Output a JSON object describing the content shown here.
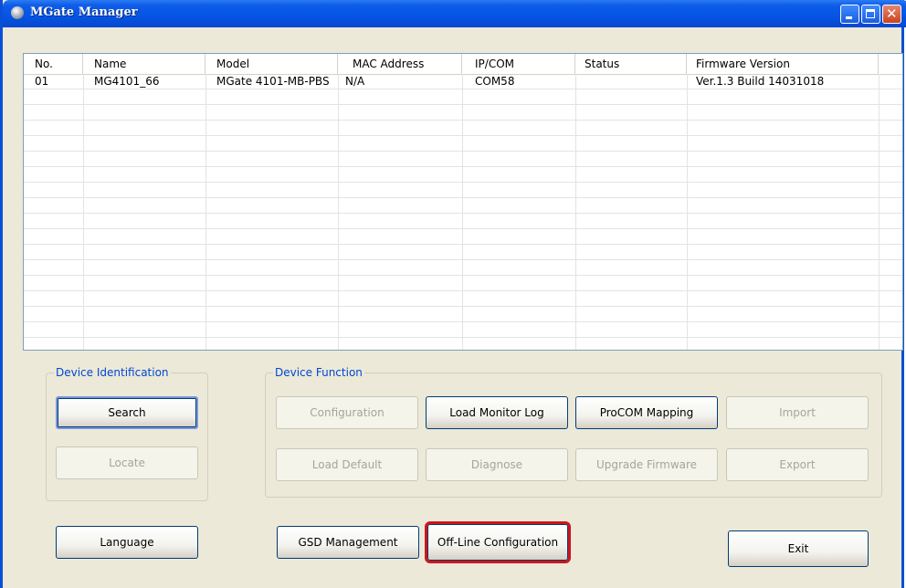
{
  "window": {
    "title": "MGate Manager"
  },
  "columns": [
    "No.",
    "Name",
    "Model",
    "MAC Address",
    "IP/COM",
    "Status",
    "Firmware Version"
  ],
  "rows": [
    [
      "01",
      "MG4101_66",
      "MGate 4101-MB-PBS",
      "N/A",
      "COM58",
      "",
      "Ver.1.3 Build 14031018"
    ]
  ],
  "device_identification": {
    "legend": "Device Identification",
    "search_label": "Search",
    "locate_label": "Locate"
  },
  "device_function": {
    "legend": "Device Function",
    "configuration_label": "Configuration",
    "load_monitor_log_label": "Load Monitor Log",
    "procom_mapping_label": "ProCOM Mapping",
    "import_label": "Import",
    "load_default_label": "Load Default",
    "diagnose_label": "Diagnose",
    "upgrade_firmware_label": "Upgrade Firmware",
    "export_label": "Export"
  },
  "bottom": {
    "language_label": "Language",
    "gsd_management_label": "GSD Management",
    "offline_configuration_label": "Off-Line Configuration",
    "exit_label": "Exit"
  },
  "highlight_color": "#d0141b"
}
